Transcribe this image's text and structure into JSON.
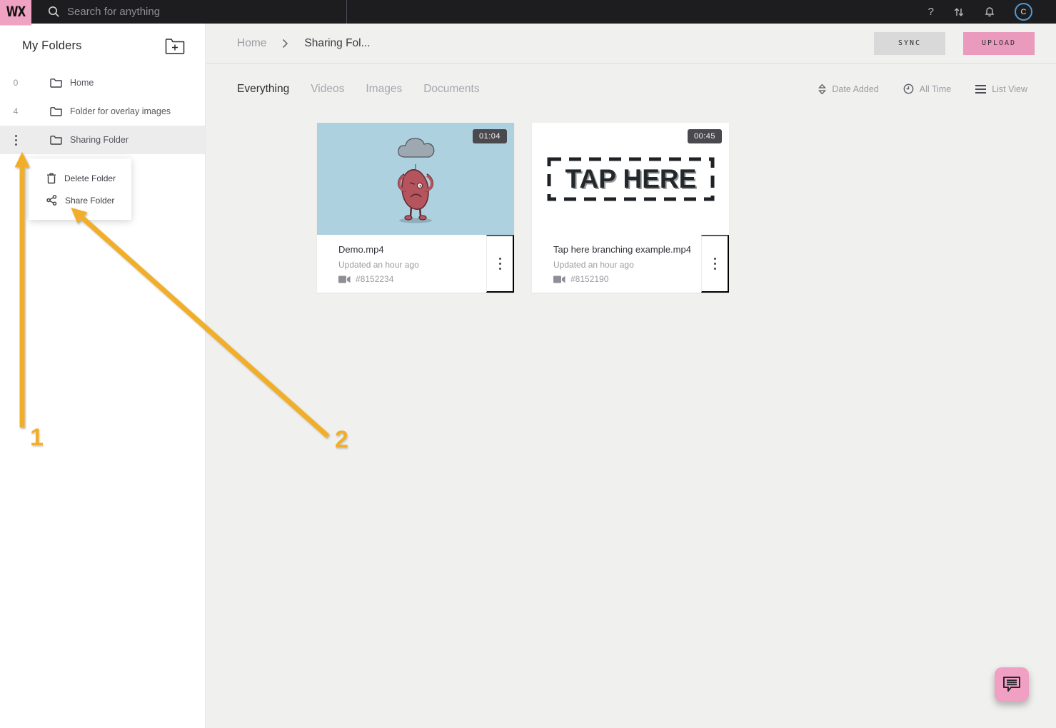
{
  "topbar": {
    "logo": "WX",
    "search_placeholder": "Search for anything",
    "avatar_letter": "C"
  },
  "sidebar": {
    "title": "My Folders",
    "items": [
      {
        "count": "0",
        "label": "Home"
      },
      {
        "count": "4",
        "label": "Folder for overlay images"
      },
      {
        "count": "",
        "label": "Sharing Folder"
      }
    ],
    "context_menu": {
      "items": [
        {
          "icon": "trash-icon",
          "label": "Delete Folder"
        },
        {
          "icon": "share-icon",
          "label": "Share Folder"
        }
      ]
    }
  },
  "header": {
    "breadcrumb": {
      "home": "Home",
      "current": "Sharing Fol..."
    },
    "sync_label": "SYNC",
    "upload_label": "UPLOAD"
  },
  "filters": {
    "tabs": [
      {
        "label": "Everything"
      },
      {
        "label": "Videos"
      },
      {
        "label": "Images"
      },
      {
        "label": "Documents"
      }
    ],
    "sort_label": "Date Added",
    "time_label": "All Time",
    "view_label": "List View"
  },
  "cards": [
    {
      "duration": "01:04",
      "title": "Demo.mp4",
      "updated": "Updated an hour ago",
      "media_id": "#8152234",
      "thumbnail": "kidney-cartoon"
    },
    {
      "duration": "00:45",
      "title": "Tap here branching example.mp4",
      "updated": "Updated an hour ago",
      "media_id": "#8152190",
      "thumbnail": "tap-here-text",
      "thumb_text": "TAP HERE"
    }
  ],
  "annotations": {
    "step1": "1",
    "step2": "2"
  },
  "colors": {
    "brand_pink": "#f0a2c2",
    "upload_pink": "#ea9abd",
    "topbar_dark": "#1d1d1f",
    "arrow_amber": "#f1ae2c",
    "thumb_blue": "#add1df",
    "avatar_ring_blue": "#4e9ad6",
    "main_bg": "#f0f0ef"
  }
}
